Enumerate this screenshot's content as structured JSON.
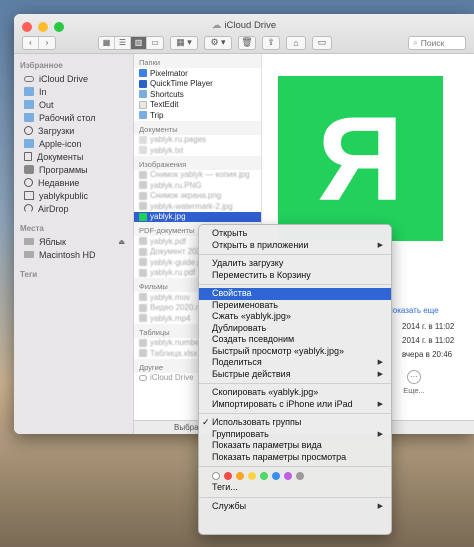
{
  "window": {
    "title": "iCloud Drive"
  },
  "toolbar": {
    "search_placeholder": "Поиск"
  },
  "sidebar": {
    "favorites_header": "Избранное",
    "favorites": [
      {
        "label": "iCloud Drive",
        "icon": "cloud-icon"
      },
      {
        "label": "In",
        "icon": "folder-icon"
      },
      {
        "label": "Out",
        "icon": "folder-icon"
      },
      {
        "label": "Рабочий стол",
        "icon": "folder-icon"
      },
      {
        "label": "Загрузки",
        "icon": "downloads-icon"
      },
      {
        "label": "Apple-icon",
        "icon": "folder-icon"
      },
      {
        "label": "Документы",
        "icon": "document-icon"
      },
      {
        "label": "Программы",
        "icon": "applications-icon"
      },
      {
        "label": "Недавние",
        "icon": "clock-icon"
      },
      {
        "label": "yablykpublic",
        "icon": "home-icon"
      },
      {
        "label": "AirDrop",
        "icon": "airdrop-icon"
      }
    ],
    "locations_header": "Места",
    "locations": [
      {
        "label": "Яблык",
        "icon": "device-icon"
      },
      {
        "label": "Macintosh HD",
        "icon": "disk-icon"
      }
    ],
    "tags_header": "Теги"
  },
  "column": {
    "folders_header": "Папки",
    "folders": [
      "Pixelmator",
      "QuickTime Player",
      "Shortcuts",
      "TextEdit",
      "Trip"
    ],
    "documents_header": "Документы",
    "documents": [
      "yablyk.ru.pages",
      "yablyk.txt"
    ],
    "images_header": "Изображения",
    "images": [
      "Снимок yablyk — копия.jpg",
      "yablyk.ru.PNG",
      "Снимок экрана.png",
      "yablyk-watermark-2.jpg"
    ],
    "selected": "yablyk.jpg",
    "pdf_header": "PDF-документы",
    "pdfs": [
      "yablyk.pdf",
      "Документ 2020.pdf",
      "yablyk-guide.pdf",
      "yablyk.ru.pdf"
    ],
    "movies_header": "Фильмы",
    "movies": [
      "yablyk.mov",
      "Видео 2020.mov",
      "yablyk.mp4"
    ],
    "tables_header": "Таблицы",
    "tables": [
      "yablyk.numbers",
      "Таблица.xlsx"
    ],
    "other_header": "Другие",
    "other": [
      "iCloud Drive"
    ]
  },
  "preview": {
    "letter": "Я",
    "show_more": "Показать еще",
    "dates": [
      "2014 г. в 11:02",
      "2014 г. в 11:02",
      "вчера в 20:46"
    ],
    "more_label": "Еще..."
  },
  "statusbar": {
    "text": "Выбрано 1"
  },
  "context_menu": {
    "group1": [
      {
        "label": "Открыть"
      },
      {
        "label": "Открыть в приложении",
        "submenu": true
      }
    ],
    "group2": [
      {
        "label": "Удалить загрузку"
      },
      {
        "label": "Переместить в Корзину"
      }
    ],
    "group3": [
      {
        "label": "Свойства",
        "highlighted": true
      },
      {
        "label": "Переименовать"
      },
      {
        "label": "Сжать «yablyk.jpg»"
      },
      {
        "label": "Дублировать"
      },
      {
        "label": "Создать псевдоним"
      },
      {
        "label": "Быстрый просмотр «yablyk.jpg»"
      },
      {
        "label": "Поделиться",
        "submenu": true
      },
      {
        "label": "Быстрые действия",
        "submenu": true
      }
    ],
    "group4": [
      {
        "label": "Скопировать «yablyk.jpg»"
      },
      {
        "label": "Импортировать с iPhone или iPad",
        "submenu": true
      }
    ],
    "group5": [
      {
        "label": "Использовать группы",
        "checked": true
      },
      {
        "label": "Группировать",
        "submenu": true
      },
      {
        "label": "Показать параметры вида"
      },
      {
        "label": "Показать параметры просмотра"
      }
    ],
    "tag_colors": [
      "#ffffff",
      "#f24b4b",
      "#f5a623",
      "#f8d540",
      "#4cd964",
      "#3b8ef0",
      "#bf5fe0",
      "#9b9b9b"
    ],
    "tags_label": "Теги...",
    "services": {
      "label": "Службы",
      "submenu": true
    }
  },
  "colors": {
    "accent": "#2f66d6",
    "preview_green": "#22d15c"
  }
}
